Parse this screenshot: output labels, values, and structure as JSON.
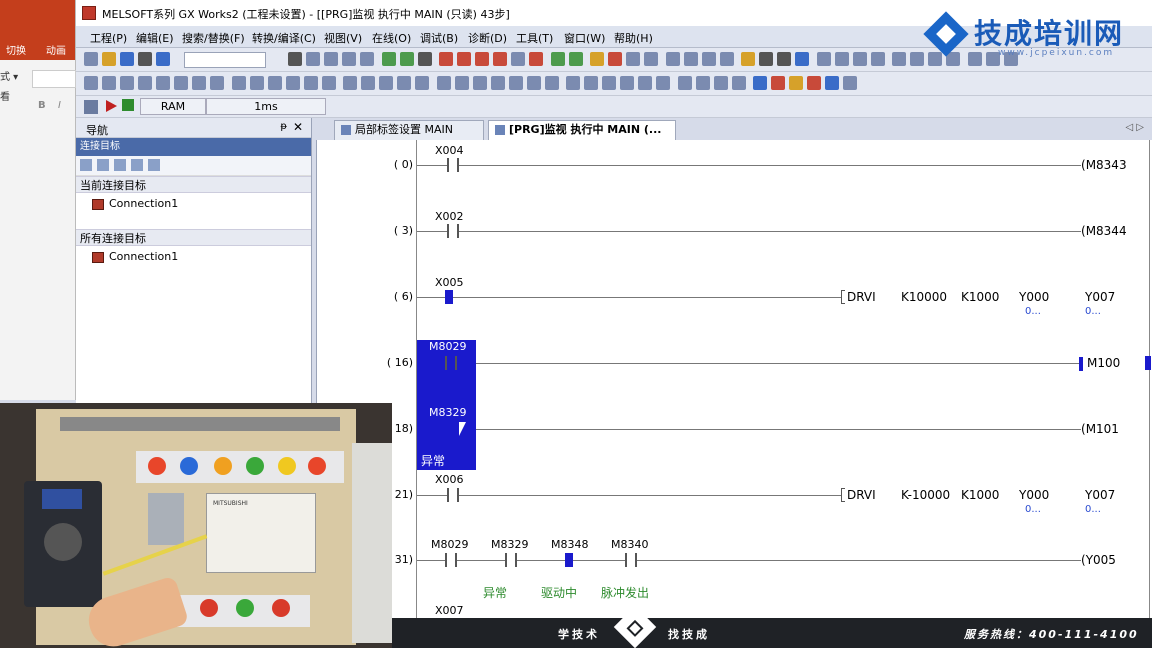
{
  "window": {
    "title": "MELSOFT系列 GX Works2 (工程未设置) - [[PRG]监视 执行中 MAIN (只读) 43步]"
  },
  "watermark": {
    "name": "技成培训网",
    "url": "www.jcpeixun.com"
  },
  "ppt": {
    "tab1": "切换",
    "tab2": "动画",
    "row1": "式 ▾",
    "row2": "看",
    "bold": "B",
    "italic": "I"
  },
  "menu": [
    "工程(P)",
    "编辑(E)",
    "搜索/替换(F)",
    "转换/编译(C)",
    "视图(V)",
    "在线(O)",
    "调试(B)",
    "诊断(D)",
    "工具(T)",
    "窗口(W)",
    "帮助(H)"
  ],
  "status": {
    "ram": "RAM",
    "scan": "1ms"
  },
  "nav": {
    "title": "导航",
    "pin": "ᵽ",
    "close": "✕",
    "bar": "连接目标",
    "current_section": "当前连接目标",
    "current_item": "Connection1",
    "all_section": "所有连接目标",
    "all_item": "Connection1"
  },
  "tabs": {
    "tab1": "局部标签设置 MAIN [PRG]",
    "tab2": "[PRG]监视 执行中 MAIN (...",
    "arrows": "◁ ▷"
  },
  "ladder": {
    "steps": [
      "( 0)",
      "( 3)",
      "( 6)",
      "( 16)",
      "( 18)",
      "( 21)",
      "( 31)"
    ],
    "r0": {
      "contact": "X004",
      "coil": "M8343"
    },
    "r3": {
      "contact": "X002",
      "coil": "M8344"
    },
    "r6": {
      "contact": "X005",
      "instr": "DRVI",
      "a1": "K10000",
      "a2": "K1000",
      "a3": "Y000",
      "a4": "Y007",
      "m3": "0...",
      "m4": "0..."
    },
    "r16": {
      "contact": "M8029",
      "coil": "M100"
    },
    "r18": {
      "contact": "M8329",
      "coil": "M101",
      "comment": "异常"
    },
    "r21": {
      "contact": "X006",
      "instr": "DRVI",
      "a1": "K-10000",
      "a2": "K1000",
      "a3": "Y000",
      "a4": "Y007",
      "m3": "0...",
      "m4": "0..."
    },
    "r31": {
      "c1": "M8029",
      "c2": "M8329",
      "c3": "M8348",
      "c4": "M8340",
      "coil": "Y005",
      "cm2": "异常",
      "cm3": "驱动中",
      "cm4": "脉冲发出"
    },
    "next_contact": "X007"
  },
  "banner": {
    "left": "学技术",
    "right": "找技成",
    "hotline": "服务热线：400-111-4100"
  }
}
